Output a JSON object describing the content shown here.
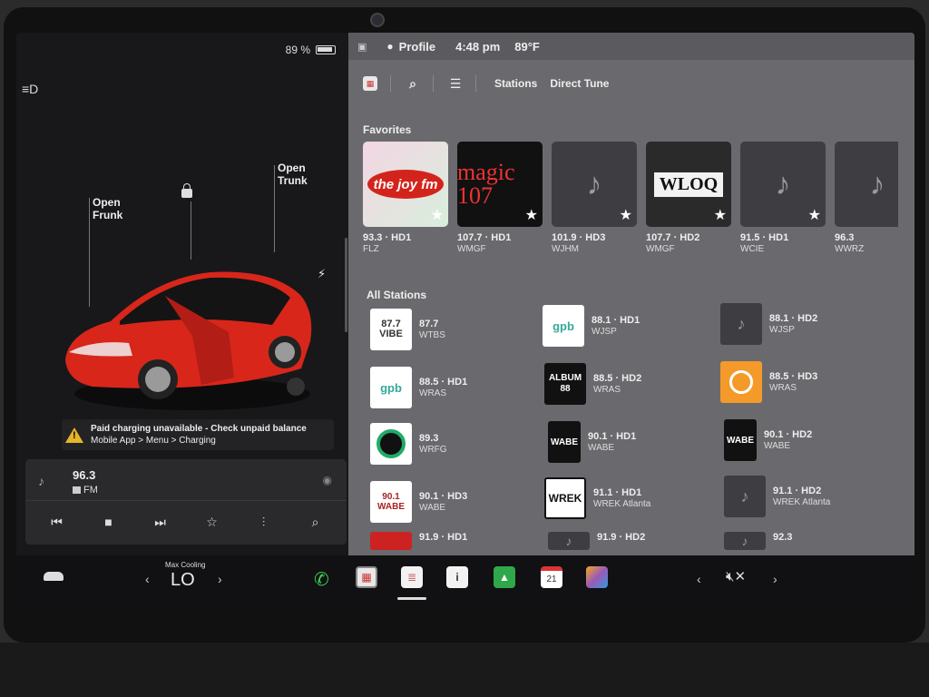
{
  "colors": {
    "accent_warning": "#e5b52a",
    "favorite_star": "#ffffff",
    "phone_green": "#3ecf4c",
    "car_red": "#d8261b"
  },
  "status": {
    "battery": "89 %",
    "profile": "Profile",
    "time": "4:48 pm",
    "temperature": "89°F"
  },
  "car": {
    "frunk_label": "Open\nFrunk",
    "trunk_label": "Open\nTrunk",
    "alert_title": "Paid charging unavailable - Check unpaid balance",
    "alert_path": "Mobile App > Menu > Charging"
  },
  "media": {
    "frequency": "96.3",
    "band": "FM"
  },
  "toolbar": {
    "tab_stations": "Stations",
    "tab_direct": "Direct Tune"
  },
  "favorites": {
    "label": "Favorites",
    "items": [
      {
        "freq": "93.3 · HD1",
        "call": "FLZ",
        "logo": "the joy fm"
      },
      {
        "freq": "107.7 · HD1",
        "call": "WMGF",
        "logo": "magic 107"
      },
      {
        "freq": "101.9 · HD3",
        "call": "WJHM",
        "logo": ""
      },
      {
        "freq": "107.7 · HD2",
        "call": "WMGF",
        "logo": "WLOQ"
      },
      {
        "freq": "91.5 · HD1",
        "call": "WCIE",
        "logo": ""
      },
      {
        "freq": "96.3",
        "call": "WWRZ",
        "logo": ""
      }
    ]
  },
  "all_stations": {
    "label": "All Stations",
    "items": [
      {
        "freq": "87.7",
        "call": "WTBS",
        "logo": "87.7 VIBE"
      },
      {
        "freq": "88.1 · HD1",
        "call": "WJSP",
        "logo": "gpb"
      },
      {
        "freq": "88.1 · HD2",
        "call": "WJSP",
        "logo": ""
      },
      {
        "freq": "88.5 · HD1",
        "call": "WRAS",
        "logo": "gpb"
      },
      {
        "freq": "88.5 · HD2",
        "call": "WRAS",
        "logo": "ALBUM 88"
      },
      {
        "freq": "88.5 · HD3",
        "call": "WRAS",
        "logo": ""
      },
      {
        "freq": "89.3",
        "call": "WRFG",
        "logo": ""
      },
      {
        "freq": "90.1 · HD1",
        "call": "WABE",
        "logo": "WABE"
      },
      {
        "freq": "90.1 · HD2",
        "call": "WABE",
        "logo": "WABE"
      },
      {
        "freq": "90.1 · HD3",
        "call": "WABE",
        "logo": "90.1 WABE"
      },
      {
        "freq": "91.1 · HD1",
        "call": "WREK Atlanta",
        "logo": "WREK"
      },
      {
        "freq": "91.1 · HD2",
        "call": "WREK Atlanta",
        "logo": ""
      },
      {
        "freq": "91.9 · HD1",
        "call": "",
        "logo": ""
      },
      {
        "freq": "91.9 · HD2",
        "call": "",
        "logo": ""
      },
      {
        "freq": "92.3",
        "call": "",
        "logo": ""
      }
    ]
  },
  "dock": {
    "climate_label": "Max Cooling",
    "climate_value": "LO",
    "calendar_day": "21"
  }
}
